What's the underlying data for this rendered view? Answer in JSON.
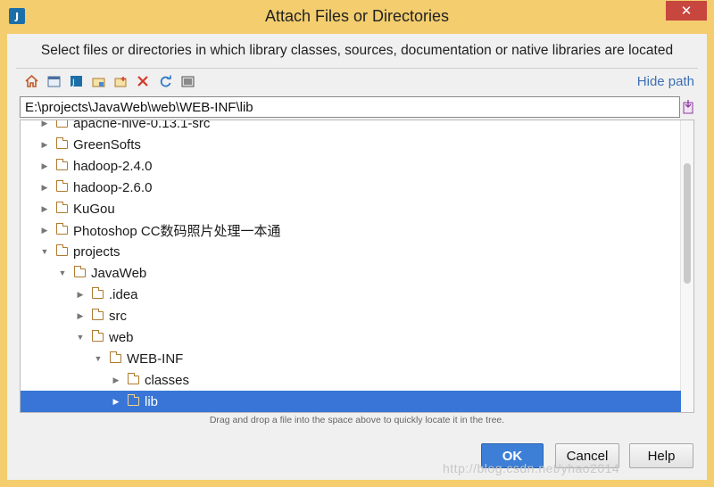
{
  "window": {
    "title": "Attach Files or Directories",
    "app_icon_text": "J",
    "close_symbol": "✕"
  },
  "description": "Select files or directories in which library classes, sources, documentation or native libraries are located",
  "toolbar": {
    "icons": [
      "home-icon",
      "desktop-icon",
      "project-icon",
      "module-icon",
      "new-folder-icon",
      "delete-icon",
      "refresh-icon",
      "show-hidden-icon"
    ],
    "hide_path_label": "Hide path"
  },
  "path": {
    "value": "E:\\projects\\JavaWeb\\web\\WEB-INF\\lib"
  },
  "tree": {
    "rows": [
      {
        "label": "apache-hive-0.13.1-src",
        "depth": 0,
        "expanded": false,
        "selected": false
      },
      {
        "label": "GreenSofts",
        "depth": 0,
        "expanded": false,
        "selected": false
      },
      {
        "label": "hadoop-2.4.0",
        "depth": 0,
        "expanded": false,
        "selected": false
      },
      {
        "label": "hadoop-2.6.0",
        "depth": 0,
        "expanded": false,
        "selected": false
      },
      {
        "label": "KuGou",
        "depth": 0,
        "expanded": false,
        "selected": false
      },
      {
        "label": "Photoshop CC数码照片处理一本通",
        "depth": 0,
        "expanded": false,
        "selected": false
      },
      {
        "label": "projects",
        "depth": 0,
        "expanded": true,
        "selected": false
      },
      {
        "label": "JavaWeb",
        "depth": 1,
        "expanded": true,
        "selected": false
      },
      {
        "label": ".idea",
        "depth": 2,
        "expanded": false,
        "selected": false
      },
      {
        "label": "src",
        "depth": 2,
        "expanded": false,
        "selected": false
      },
      {
        "label": "web",
        "depth": 2,
        "expanded": true,
        "selected": false
      },
      {
        "label": "WEB-INF",
        "depth": 3,
        "expanded": true,
        "selected": false
      },
      {
        "label": "classes",
        "depth": 4,
        "expanded": false,
        "selected": false
      },
      {
        "label": "lib",
        "depth": 4,
        "expanded": false,
        "selected": true
      }
    ]
  },
  "hint": "Drag and drop a file into the space above to quickly locate it in the tree.",
  "buttons": {
    "ok": "OK",
    "cancel": "Cancel",
    "help": "Help"
  },
  "watermark": "http://blog.csdn.net/yhao2014",
  "colors": {
    "selection": "#3875d7",
    "link": "#3d6fb3",
    "title_bar": "#f3cd6e",
    "close": "#c7463e"
  }
}
